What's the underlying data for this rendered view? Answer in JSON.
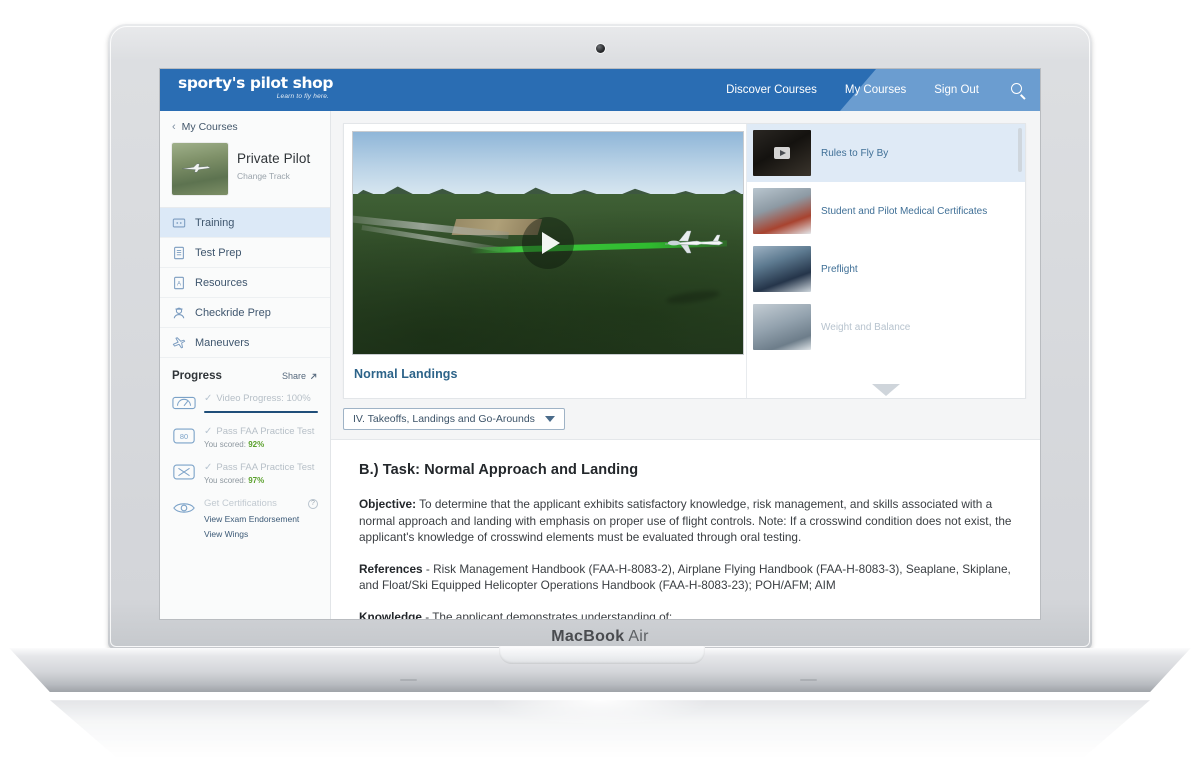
{
  "device": {
    "model_main": "MacBook",
    "model_sub": "Air"
  },
  "header": {
    "logo_main": "sporty's pilot shop",
    "logo_tagline": "Learn to fly here.",
    "nav": [
      {
        "label": "Discover Courses"
      },
      {
        "label": "My Courses"
      },
      {
        "label": "Sign Out"
      }
    ],
    "search_icon": "search-icon",
    "color_primary": "#2a6db3",
    "color_secondary": "#6b9dd0"
  },
  "sidebar": {
    "breadcrumb": "My Courses",
    "breadcrumb_chevron": "‹",
    "course": {
      "title": "Private Pilot",
      "change_track": "Change Track"
    },
    "nav_items": [
      {
        "label": "Training",
        "icon": "video-icon",
        "active": true
      },
      {
        "label": "Test Prep",
        "icon": "list-icon",
        "active": false
      },
      {
        "label": "Resources",
        "icon": "pdf-icon",
        "active": false
      },
      {
        "label": "Checkride Prep",
        "icon": "pilot-icon",
        "active": false
      },
      {
        "label": "Maneuvers",
        "icon": "airplane-icon",
        "active": false
      }
    ],
    "progress": {
      "title": "Progress",
      "share_label": "Share",
      "share_icon": "external-link-icon",
      "rows": [
        {
          "label": "Video Progress: 100%",
          "icon": "video-progress-icon",
          "check": "✓",
          "bar_percent": 100
        },
        {
          "label": "Pass FAA Practice Test",
          "icon": "score-80-icon",
          "check": "✓",
          "score_prefix": "You scored:",
          "score": "92%"
        },
        {
          "label": "Pass FAA Practice Test",
          "icon": "score-2-icon",
          "check": "✓",
          "score_prefix": "You scored:",
          "score": "97%"
        },
        {
          "label": "Get Certifications",
          "icon": "certification-icon",
          "info_icon": "info-icon",
          "links": [
            "View Exam Endorsement",
            "View Wings"
          ]
        }
      ],
      "score_color": "#5aa02c",
      "bar_color": "#1f4e79"
    }
  },
  "main": {
    "video": {
      "title": "Normal Landings",
      "play_icon": "play-icon"
    },
    "playlist": [
      {
        "label": "Rules to Fly By",
        "active": true,
        "has_play": true
      },
      {
        "label": "Student and Pilot Medical Certificates",
        "active": false,
        "has_play": false
      },
      {
        "label": "Preflight",
        "active": false,
        "has_play": false
      },
      {
        "label": "Weight and Balance",
        "active": false,
        "has_play": false
      }
    ],
    "playlist_more_icon": "chevron-down-icon",
    "selector": {
      "value": "IV. Takeoffs, Landings and Go-Arounds",
      "caret_icon": "caret-down-icon"
    },
    "content": {
      "heading": "B.) Task: Normal Approach and Landing",
      "paragraphs": [
        {
          "lead": "Objective:",
          "text": " To determine that the applicant exhibits satisfactory knowledge, risk management, and skills associated with a normal approach and landing with emphasis on proper use of flight controls. Note: If a crosswind condition does not exist, the applicant's knowledge of crosswind elements must be evaluated through oral testing."
        },
        {
          "lead": "References",
          "text": " - Risk Management Handbook (FAA-H-8083-2), Airplane Flying Handbook (FAA-H-8083-3), Seaplane, Skiplane, and Float/Ski Equipped Helicopter Operations Handbook (FAA-H-8083-23); POH/AFM; AIM"
        },
        {
          "lead": "Knowledge",
          "text": " - The applicant demonstrates understanding of:"
        }
      ]
    }
  }
}
